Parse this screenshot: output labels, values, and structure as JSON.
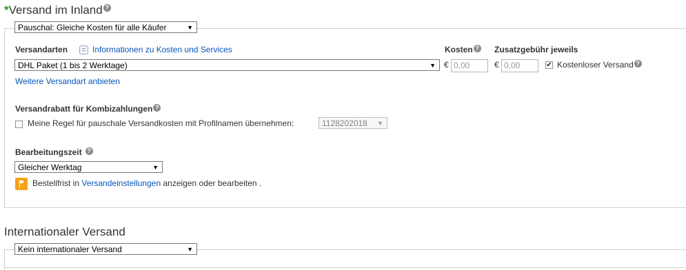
{
  "domestic": {
    "required_mark": "*",
    "title": "Versand im Inland",
    "help_mark": "?",
    "pricing_select": "Pauschal: Gleiche Kosten für alle Käufer",
    "shipping_types_label": "Versandarten",
    "info_link": "Informationen zu Kosten und Services",
    "service_select": "DHL Paket (1 bis 2 Werktage)",
    "cost_label": "Kosten",
    "extra_fee_label": "Zusatzgebühr jeweils",
    "currency": "€",
    "cost_placeholder": "0,00",
    "extra_fee_placeholder": "0,00",
    "free_shipping_label": "Kostenloser Versand",
    "free_shipping_checked": true,
    "add_service_link": "Weitere Versandart anbieten",
    "discount_label": "Versandrabatt für Kombizahlungen",
    "rule_label": "Meine Regel für pauschale Versandkosten mit Profilnamen übernehmen:",
    "rule_checked": false,
    "profile_select": "1128202018",
    "handling_label": "Bearbeitungszeit",
    "handling_select": "Gleicher Werktag",
    "cutoff_prefix": "Bestellfrist in",
    "cutoff_link": "Versandeinstellungen",
    "cutoff_suffix": "anzeigen oder bearbeiten ."
  },
  "international": {
    "title": "Internationaler Versand",
    "select": "Kein internationaler Versand"
  },
  "colors": {
    "link": "#0654ba",
    "required": "#2a9b2a",
    "flag_icon": "#f4a21a"
  },
  "icons": {
    "dropdown": "▼",
    "info": "info-icon",
    "flag": "flag-icon",
    "check": "✔"
  }
}
